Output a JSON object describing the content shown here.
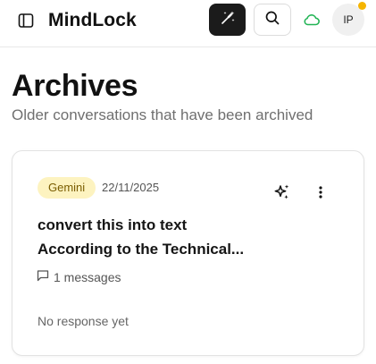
{
  "app": {
    "title": "MindLock"
  },
  "header": {
    "icons": {
      "sidebar": "sidebar-toggle-icon",
      "magic": "magic-wand-icon",
      "search": "search-icon",
      "cloud": "cloud-icon"
    },
    "avatar_initials": "IP"
  },
  "page": {
    "title": "Archives",
    "subtitle": "Older conversations that have been archived"
  },
  "conversations": [
    {
      "model": "Gemini",
      "date": "22/11/2025",
      "title_line1": "convert this into text",
      "title_line2": "According to the Technical...",
      "message_count": "1 messages",
      "response_status": "No response yet"
    }
  ],
  "colors": {
    "accent_dark": "#1b1b1b",
    "cloud_green": "#22b455",
    "badge_bg": "#fdf3c0",
    "notification_dot": "#f5b400"
  }
}
